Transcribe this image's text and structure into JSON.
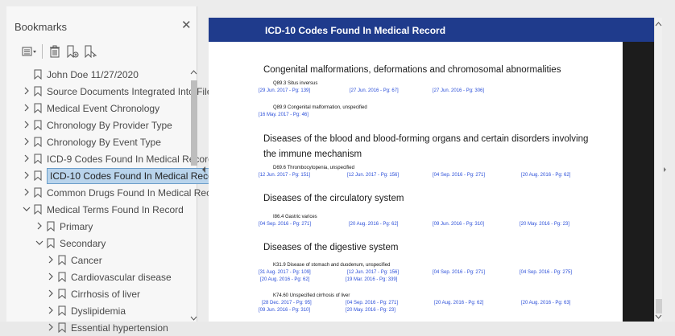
{
  "sidebar": {
    "title": "Bookmarks",
    "close_icon": "close-icon",
    "toolbar": [
      "options-menu-icon",
      "delete-icon",
      "new-bookmark-icon",
      "bookmark-properties-icon"
    ],
    "items": [
      {
        "label": "John Doe 11/27/2020",
        "level": 0,
        "expandable": false,
        "expanded": false
      },
      {
        "label": "Source Documents Integrated Into File",
        "level": 0,
        "expandable": true,
        "expanded": false
      },
      {
        "label": "Medical Event Chronology",
        "level": 0,
        "expandable": true,
        "expanded": false
      },
      {
        "label": "Chronology By Provider Type",
        "level": 0,
        "expandable": true,
        "expanded": false
      },
      {
        "label": "Chronology By Event Type",
        "level": 0,
        "expandable": true,
        "expanded": false
      },
      {
        "label": "ICD-9 Codes Found In Medical Record",
        "level": 0,
        "expandable": true,
        "expanded": false
      },
      {
        "label": "ICD-10 Codes Found In Medical Record",
        "level": 0,
        "expandable": true,
        "expanded": false,
        "selected": true
      },
      {
        "label": "Common Drugs Found In Medical Record",
        "level": 0,
        "expandable": true,
        "expanded": false
      },
      {
        "label": "Medical Terms Found In Record",
        "level": 0,
        "expandable": true,
        "expanded": true
      },
      {
        "label": "Primary",
        "level": 1,
        "expandable": true,
        "expanded": false
      },
      {
        "label": "Secondary",
        "level": 1,
        "expandable": true,
        "expanded": true
      },
      {
        "label": "Cancer",
        "level": 2,
        "expandable": true,
        "expanded": false
      },
      {
        "label": "Cardiovascular disease",
        "level": 2,
        "expandable": true,
        "expanded": false
      },
      {
        "label": "Cirrhosis of liver",
        "level": 2,
        "expandable": true,
        "expanded": false
      },
      {
        "label": "Dyslipidemia",
        "level": 2,
        "expandable": true,
        "expanded": false
      },
      {
        "label": "Essential hypertension",
        "level": 2,
        "expandable": true,
        "expanded": false
      }
    ]
  },
  "document": {
    "title": "ICD-10 Codes Found In Medical Record",
    "sections": [
      {
        "heading": "Congenital malformations, deformations and chromosomal abnormalities",
        "codes": [
          {
            "code": "Q89.3 Situs inversus",
            "refs": [
              "[29 Jun. 2017 - Pg: 139]",
              "[27 Jun. 2016 - Pg: 67]",
              "[27 Jun. 2016 - Pg: 306]"
            ]
          },
          {
            "code": "Q89.9 Congenital malformation, unspecified",
            "refs": [
              "[16 May. 2017 - Pg: 46]"
            ]
          }
        ]
      },
      {
        "heading": "Diseases of the blood and blood-forming organs and certain disorders  involving the immune mechanism",
        "codes": [
          {
            "code": "D69.6 Thrombocytopenia, unspecified",
            "refs": [
              "[12 Jun. 2017 - Pg: 151]",
              "[12 Jun. 2017 - Pg: 156]",
              "[04 Sep. 2016 - Pg: 271]",
              "[20 Aug. 2016 - Pg: 62]"
            ]
          }
        ]
      },
      {
        "heading": "Diseases of the circulatory system",
        "codes": [
          {
            "code": "I86.4 Gastric varices",
            "refs": [
              "[04 Sep. 2016 - Pg: 271]",
              "[20 Aug. 2016 - Pg: 62]",
              "[09 Jun. 2016 - Pg: 310]",
              "[20 May. 2016 - Pg: 23]"
            ]
          }
        ]
      },
      {
        "heading": "Diseases of the digestive system",
        "codes": [
          {
            "code": "K31.9 Disease of stomach and duodenum, unspecified",
            "refs": [
              "[31 Aug. 2017 - Pg: 109]",
              "[12 Jun. 2017 - Pg: 156]",
              "[04 Sep. 2016 - Pg: 271]",
              "[04 Sep. 2016 - Pg: 275]",
              "[20 Aug. 2016 - Pg: 62]",
              "[19 Mar. 2016 - Pg: 339]"
            ]
          },
          {
            "code": "K74.60 Unspecified cirrhosis of liver",
            "refs": [
              "[28 Dec. 2017 - Pg: 95]",
              "[04 Sep. 2016 - Pg: 271]",
              "[20 Aug. 2016 - Pg: 62]",
              "[20 Aug. 2016 - Pg: 63]",
              "[09 Jun. 2016 - Pg: 310]",
              "[20 May. 2016 - Pg: 23]"
            ]
          }
        ]
      }
    ]
  },
  "colors": {
    "header_blue": "#1f3b8c",
    "link_blue": "#2a4ed8",
    "selection_fill": "#b9d4ec"
  }
}
